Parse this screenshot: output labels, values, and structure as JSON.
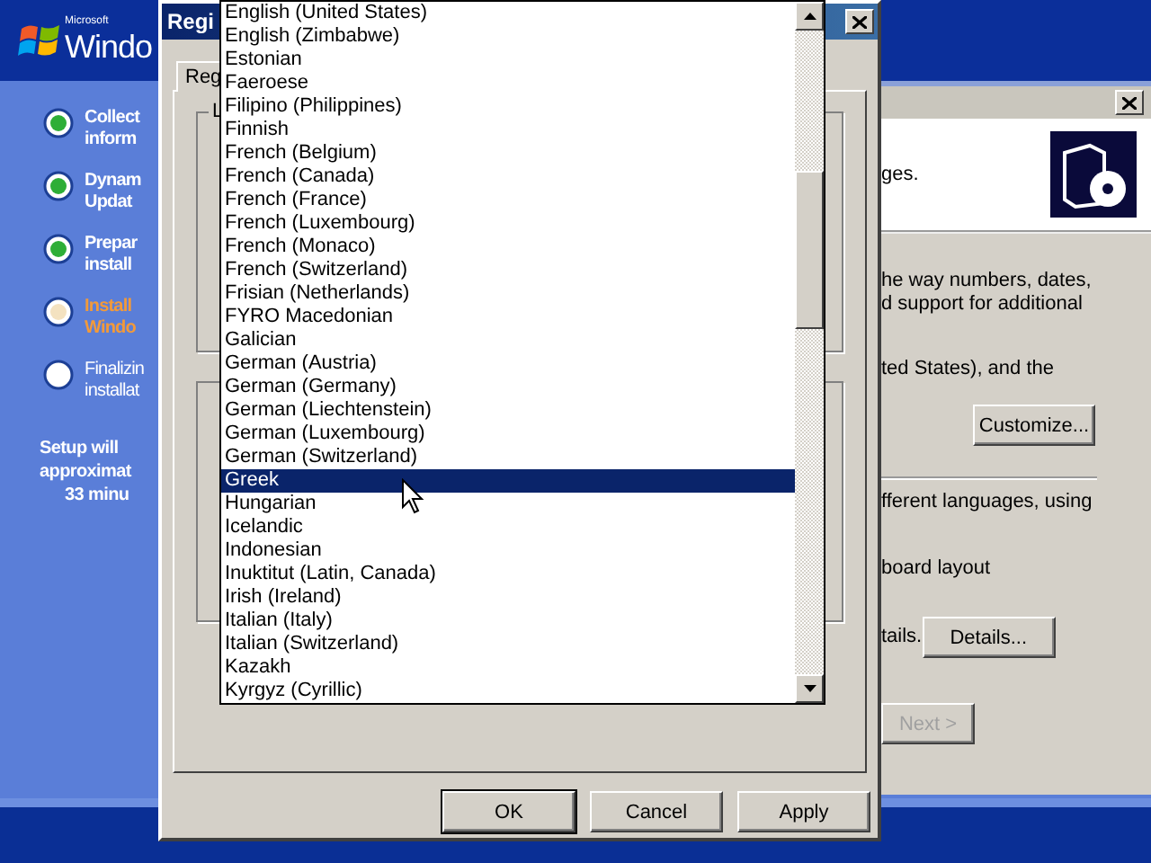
{
  "setup": {
    "logo": {
      "brand": "Microsoft",
      "name": "Windo"
    },
    "steps": [
      {
        "lines": [
          "Collect",
          "inform"
        ],
        "kind": "done"
      },
      {
        "lines": [
          "Dynam",
          "Updat"
        ],
        "kind": "done"
      },
      {
        "lines": [
          "Prepar",
          "install"
        ],
        "kind": "done"
      },
      {
        "lines": [
          "Install",
          "Windo"
        ],
        "kind": "current"
      },
      {
        "lines": [
          "Finalizin",
          "installat"
        ],
        "kind": "pending"
      }
    ],
    "estimate": [
      "Setup will",
      "approximat",
      "33 minu"
    ]
  },
  "wizard": {
    "header_text": "ges.",
    "sections": [
      {
        "lines": [
          "he way numbers, dates,",
          "d support for additional"
        ]
      },
      {
        "lines": [
          "ted States), and the"
        ],
        "button": "Customize..."
      },
      {
        "lines": [
          "fferent languages, using"
        ],
        "divider": true
      },
      {
        "lines": [
          "board layout"
        ]
      },
      {
        "lines": [
          "tails."
        ],
        "button": "Details..."
      }
    ],
    "next": {
      "label": "Next >",
      "disabled": true
    }
  },
  "dialog": {
    "title": "Regi",
    "tab": {
      "label": "Reg",
      "selected": true
    },
    "group_label": "L",
    "buttons": [
      "OK",
      "Cancel",
      "Apply"
    ]
  },
  "dropdown": {
    "items": [
      {
        "label": "English (United States)",
        "selected": false
      },
      {
        "label": "English (Zimbabwe)",
        "selected": false
      },
      {
        "label": "Estonian",
        "selected": false
      },
      {
        "label": "Faeroese",
        "selected": false
      },
      {
        "label": "Filipino (Philippines)",
        "selected": false
      },
      {
        "label": "Finnish",
        "selected": false
      },
      {
        "label": "French (Belgium)",
        "selected": false
      },
      {
        "label": "French (Canada)",
        "selected": false
      },
      {
        "label": "French (France)",
        "selected": false
      },
      {
        "label": "French (Luxembourg)",
        "selected": false
      },
      {
        "label": "French (Monaco)",
        "selected": false
      },
      {
        "label": "French (Switzerland)",
        "selected": false
      },
      {
        "label": "Frisian (Netherlands)",
        "selected": false
      },
      {
        "label": "FYRO Macedonian",
        "selected": false
      },
      {
        "label": "Galician",
        "selected": false
      },
      {
        "label": "German (Austria)",
        "selected": false
      },
      {
        "label": "German (Germany)",
        "selected": false
      },
      {
        "label": "German (Liechtenstein)",
        "selected": false
      },
      {
        "label": "German (Luxembourg)",
        "selected": false
      },
      {
        "label": "German (Switzerland)",
        "selected": false
      },
      {
        "label": "Greek",
        "selected": true
      },
      {
        "label": "Hungarian",
        "selected": false
      },
      {
        "label": "Icelandic",
        "selected": false
      },
      {
        "label": "Indonesian",
        "selected": false
      },
      {
        "label": "Inuktitut (Latin, Canada)",
        "selected": false
      },
      {
        "label": "Irish (Ireland)",
        "selected": false
      },
      {
        "label": "Italian (Italy)",
        "selected": false
      },
      {
        "label": "Italian (Switzerland)",
        "selected": false
      },
      {
        "label": "Kazakh",
        "selected": false
      },
      {
        "label": "Kyrgyz (Cyrillic)",
        "selected": false
      }
    ]
  }
}
